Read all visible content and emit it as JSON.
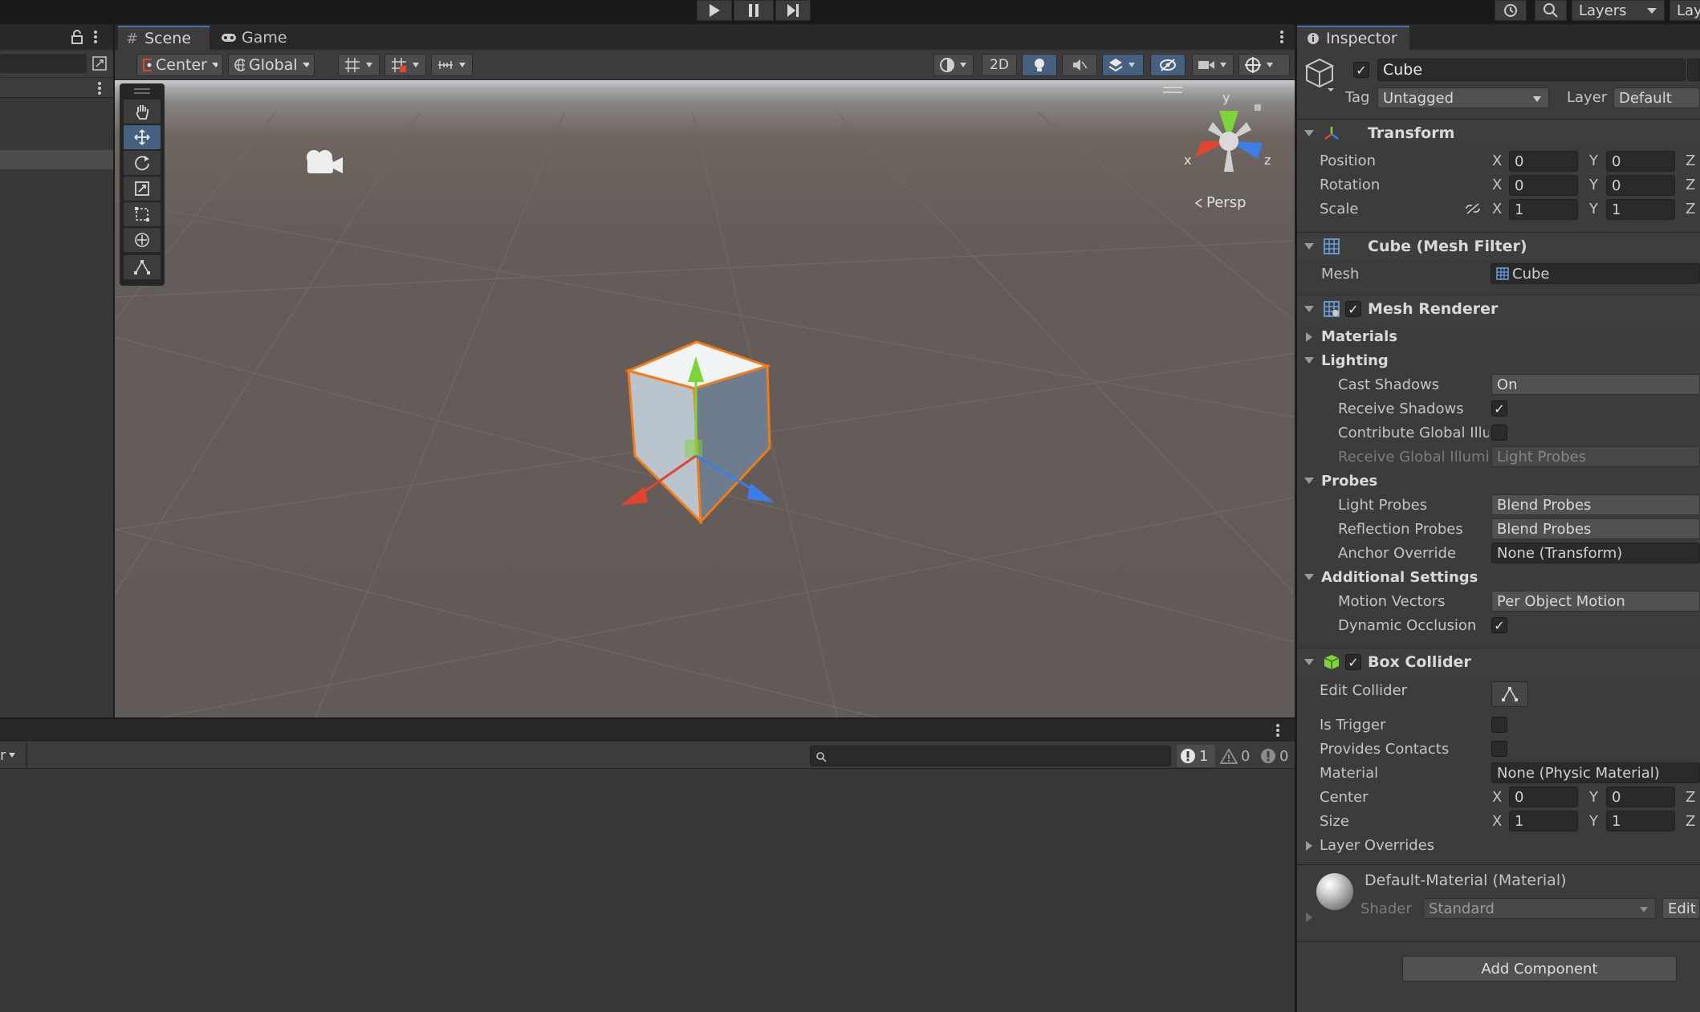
{
  "playbar": {
    "play_icon": "play-icon",
    "pause_icon": "pause-icon",
    "step_icon": "step-icon"
  },
  "topright": {
    "layers_label": "Layers",
    "layout_label": "Lay"
  },
  "scene_tabs": {
    "scene": "Scene",
    "game": "Game"
  },
  "scene_toolbar": {
    "pivot": "Center",
    "space": "Global",
    "mode_2d": "2D"
  },
  "viewport": {
    "projection_label": "Persp",
    "axis_x": "x",
    "axis_y": "y",
    "axis_z": "z"
  },
  "console": {
    "error_count": "1",
    "warning_count": "0",
    "info_count": "0",
    "left_dropdown": "r"
  },
  "inspector": {
    "tab": "Inspector",
    "object_name": "Cube",
    "tag_label": "Tag",
    "tag_value": "Untagged",
    "layer_label": "Layer",
    "layer_value": "Default",
    "transform": {
      "title": "Transform",
      "position_label": "Position",
      "rotation_label": "Rotation",
      "scale_label": "Scale",
      "x": "X",
      "y": "Y",
      "z": "Z",
      "position": [
        "0",
        "0"
      ],
      "rotation": [
        "0",
        "0"
      ],
      "scale": [
        "1",
        "1"
      ]
    },
    "mesh_filter": {
      "title": "Cube (Mesh Filter)",
      "mesh_label": "Mesh",
      "mesh_value": "Cube"
    },
    "mesh_renderer": {
      "title": "Mesh Renderer",
      "materials": "Materials",
      "lighting": "Lighting",
      "cast_shadows_label": "Cast Shadows",
      "cast_shadows_value": "On",
      "receive_shadows_label": "Receive Shadows",
      "contribute_gi_label": "Contribute Global Illu",
      "receive_gi_label": "Receive Global Illumi",
      "receive_gi_value": "Light Probes",
      "probes": "Probes",
      "light_probes_label": "Light Probes",
      "light_probes_value": "Blend Probes",
      "reflection_probes_label": "Reflection Probes",
      "reflection_probes_value": "Blend Probes",
      "anchor_override_label": "Anchor Override",
      "anchor_override_value": "None (Transform)",
      "additional_settings": "Additional Settings",
      "motion_vectors_label": "Motion Vectors",
      "motion_vectors_value": "Per Object Motion",
      "dynamic_occlusion_label": "Dynamic Occlusion"
    },
    "box_collider": {
      "title": "Box Collider",
      "edit_collider_label": "Edit Collider",
      "is_trigger_label": "Is Trigger",
      "provides_contacts_label": "Provides Contacts",
      "material_label": "Material",
      "material_value": "None (Physic Material)",
      "center_label": "Center",
      "center": [
        "0",
        "0"
      ],
      "size_label": "Size",
      "size": [
        "1",
        "1"
      ],
      "layer_overrides": "Layer Overrides"
    },
    "material": {
      "name": "Default-Material (Material)",
      "shader_label": "Shader",
      "shader_value": "Standard",
      "edit_label": "Edit"
    },
    "add_component": "Add Component"
  },
  "colors": {
    "accent_blue": "#4a6fa5",
    "selection_orange": "#f07b18",
    "x_axis": "#e0462f",
    "y_axis": "#7fd33a",
    "z_axis": "#3d7de6"
  }
}
